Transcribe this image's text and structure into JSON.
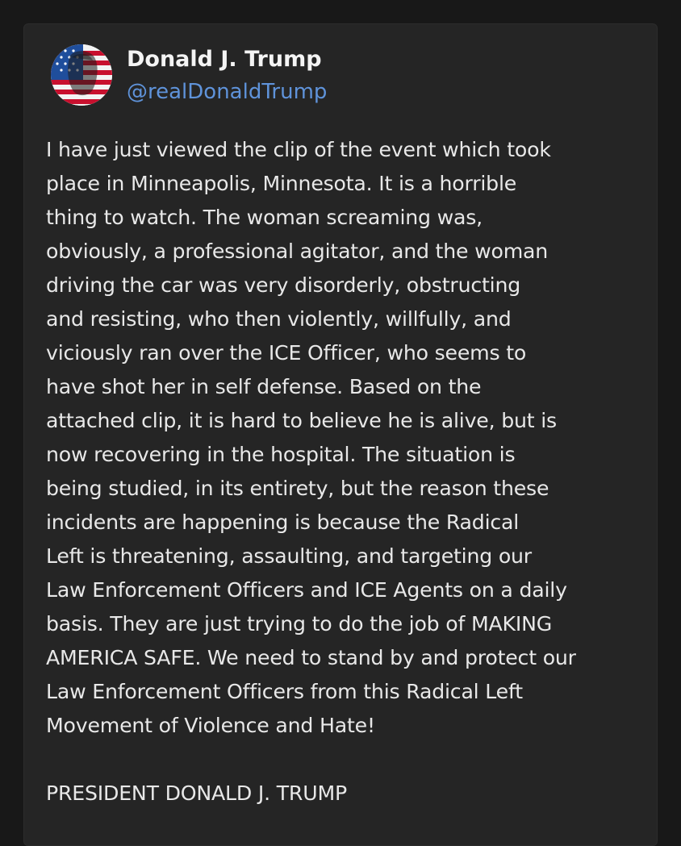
{
  "post": {
    "author": {
      "name": "Donald J. Trump",
      "handle": "@realDonaldTrump",
      "avatar_icon": "flag-portrait-avatar"
    },
    "body_lines": [
      "I have just viewed the clip of the event which took",
      "place in Minneapolis, Minnesota. It is a horrible",
      "thing to watch. The woman screaming was,",
      "obviously, a professional agitator, and the woman",
      "driving the car was very disorderly, obstructing",
      "and resisting, who then violently, willfully, and",
      "viciously ran over the ICE Officer, who seems to",
      "have shot her in self defense. Based on the",
      "attached clip, it is hard to believe he is alive, but is",
      "now recovering in the hospital. The situation is",
      "being studied, in its entirety, but the reason these",
      "incidents are happening is because the Radical",
      "Left is threatening, assaulting, and targeting our",
      "Law Enforcement Officers and ICE Agents on a daily",
      "basis. They are just trying to do the job of MAKING",
      "AMERICA SAFE. We need to stand by and protect our",
      "Law Enforcement Officers from this Radical Left",
      "Movement of Violence and Hate!"
    ],
    "signature": "PRESIDENT DONALD J. TRUMP"
  },
  "colors": {
    "background": "#181818",
    "card": "#252525",
    "text": "#e8e8e8",
    "name": "#f4f4f4",
    "handle": "#5f93da"
  }
}
